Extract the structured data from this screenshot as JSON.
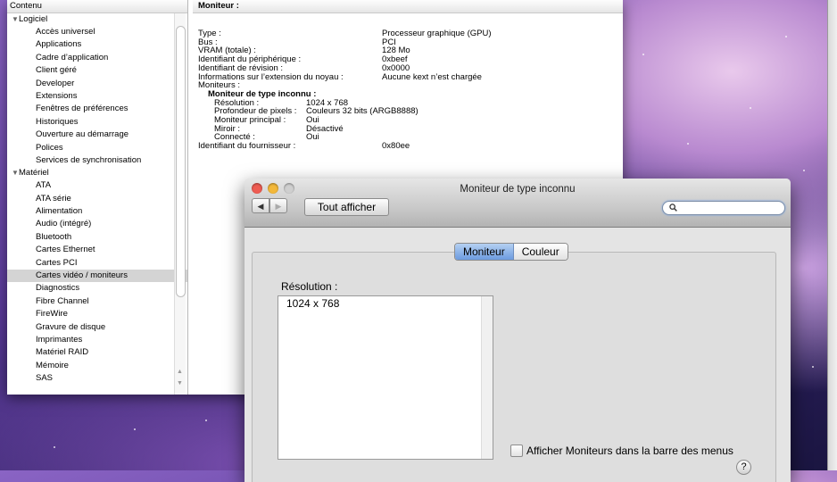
{
  "profiler": {
    "sidebar_header": "Contenu",
    "groups": [
      {
        "label": "Logiciel",
        "items": [
          "Accès universel",
          "Applications",
          "Cadre d’application",
          "Client géré",
          "Developer",
          "Extensions",
          "Fenêtres de préférences",
          "Historiques",
          "Ouverture au démarrage",
          "Polices",
          "Services de synchronisation"
        ]
      },
      {
        "label": "Matériel",
        "items": [
          "ATA",
          "ATA série",
          "Alimentation",
          "Audio (intégré)",
          "Bluetooth",
          "Cartes Ethernet",
          "Cartes PCI",
          "Cartes vidéo / moniteurs",
          "Diagnostics",
          "Fibre Channel",
          "FireWire",
          "Gravure de disque",
          "Imprimantes",
          "Matériel RAID",
          "Mémoire",
          "SAS"
        ]
      }
    ],
    "selected_item": "Cartes vidéo / moniteurs",
    "detail_header": "Moniteur :",
    "details": [
      {
        "key": "Type :",
        "value": "Processeur graphique (GPU)"
      },
      {
        "key": "Bus :",
        "value": "PCI"
      },
      {
        "key": "VRAM (totale) :",
        "value": "128 Mo"
      },
      {
        "key": "Identifiant du périphérique :",
        "value": "0xbeef"
      },
      {
        "key": "Identifiant de révision :",
        "value": "0x0000"
      },
      {
        "key": "Informations sur l’extension du noyau :",
        "value": "Aucune kext n’est chargée"
      },
      {
        "key": "Moniteurs :",
        "value": ""
      }
    ],
    "monitor_heading": "Moniteur de type inconnu :",
    "monitor_details": [
      {
        "key": "Résolution :",
        "value": "1024 x 768"
      },
      {
        "key": "Profondeur de pixels :",
        "value": "Couleurs 32 bits (ARGB8888)"
      },
      {
        "key": "Moniteur principal :",
        "value": "Oui"
      },
      {
        "key": "Miroir :",
        "value": "Désactivé"
      },
      {
        "key": "Connecté :",
        "value": "Oui"
      }
    ],
    "vendor": {
      "key": "Identifiant du fournisseur :",
      "value": "0x80ee"
    }
  },
  "prefs": {
    "title": "Moniteur de type inconnu",
    "back_icon": "◀",
    "forward_icon": "▶",
    "show_all": "Tout afficher",
    "search_placeholder": "",
    "tabs": [
      "Moniteur",
      "Couleur"
    ],
    "active_tab": "Moniteur",
    "resolution_label": "Résolution :",
    "resolutions": [
      "1024 x 768"
    ],
    "menu_checkbox": "Afficher Moniteurs dans la barre des menus",
    "help": "?"
  },
  "colors": {
    "close": "#ee5c52",
    "minimize": "#f3b83a",
    "zoom": "#cfcfcf",
    "selection": "#d4d4d4",
    "tab_active": "#6c9be0"
  }
}
